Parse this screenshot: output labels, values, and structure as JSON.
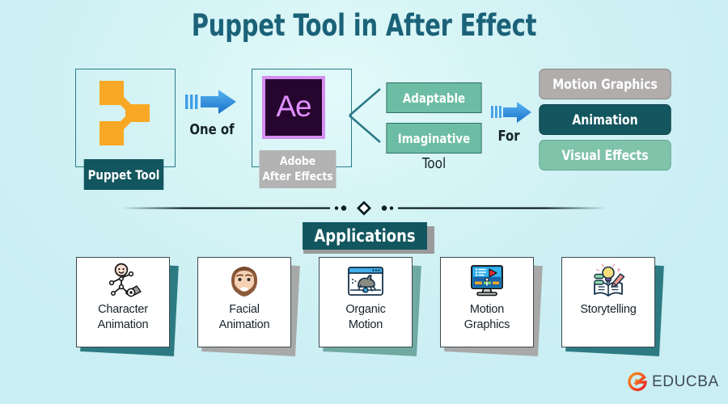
{
  "title": "Puppet Tool in After Effect",
  "colors": {
    "background": "#d4f3f5",
    "title_teal": "#1b6279",
    "dark_teal": "#12565f",
    "green_box": "#6cbda4",
    "light_green": "#80c3ab",
    "gray_pill": "#b0adac",
    "orange_icon": "#f9a825",
    "ae_purple": "#e08fff",
    "ae_bg": "#26062e",
    "arrow_blue": "#2f8fe0",
    "educba_orange": "#f05a28"
  },
  "flow": {
    "source": {
      "icon": "puppet-tool-mesh-icon",
      "label": "Puppet Tool"
    },
    "connector_one": {
      "icon": "blue-right-arrow-icon",
      "label": "One of"
    },
    "product": {
      "logo_text": "Ae",
      "icon": "adobe-after-effects-logo-icon",
      "label_line1": "Adobe",
      "label_line2": "After Effects"
    },
    "attributes": {
      "items": [
        {
          "label": "Adaptable"
        },
        {
          "label": "Imaginative"
        }
      ],
      "caption": "Tool"
    },
    "connector_two": {
      "icon": "blue-right-arrow-icon",
      "label": "For"
    },
    "use_cases": [
      {
        "label": "Motion Graphics",
        "style": "gray"
      },
      {
        "label": "Animation",
        "style": "dark-teal"
      },
      {
        "label": "Visual Effects",
        "style": "light-green"
      }
    ]
  },
  "applications": {
    "banner_label": "Applications",
    "cards": [
      {
        "label_line1": "Character",
        "label_line2": "Animation",
        "icon": "stick-figure-puppet-icon",
        "shadow_color": "#2d7b82"
      },
      {
        "label_line1": "Facial",
        "label_line2": "Animation",
        "icon": "bearded-face-icon",
        "shadow_color": "#a8a8a8"
      },
      {
        "label_line1": "Organic",
        "label_line2": "Motion",
        "icon": "rabbit-in-browser-window-icon",
        "shadow_color": "#6fa9a2"
      },
      {
        "label_line1": "Motion",
        "label_line2": "Graphics",
        "icon": "monitor-timeline-icon",
        "shadow_color": "#a8a8a8"
      },
      {
        "label_line1": "Storytelling",
        "label_line2": "",
        "icon": "book-lightbulb-pencil-icon",
        "shadow_color": "#2d7b82"
      }
    ]
  },
  "branding": {
    "logo_text": "EDUCBA",
    "logo_mark": "educba-swoosh-play-icon"
  }
}
